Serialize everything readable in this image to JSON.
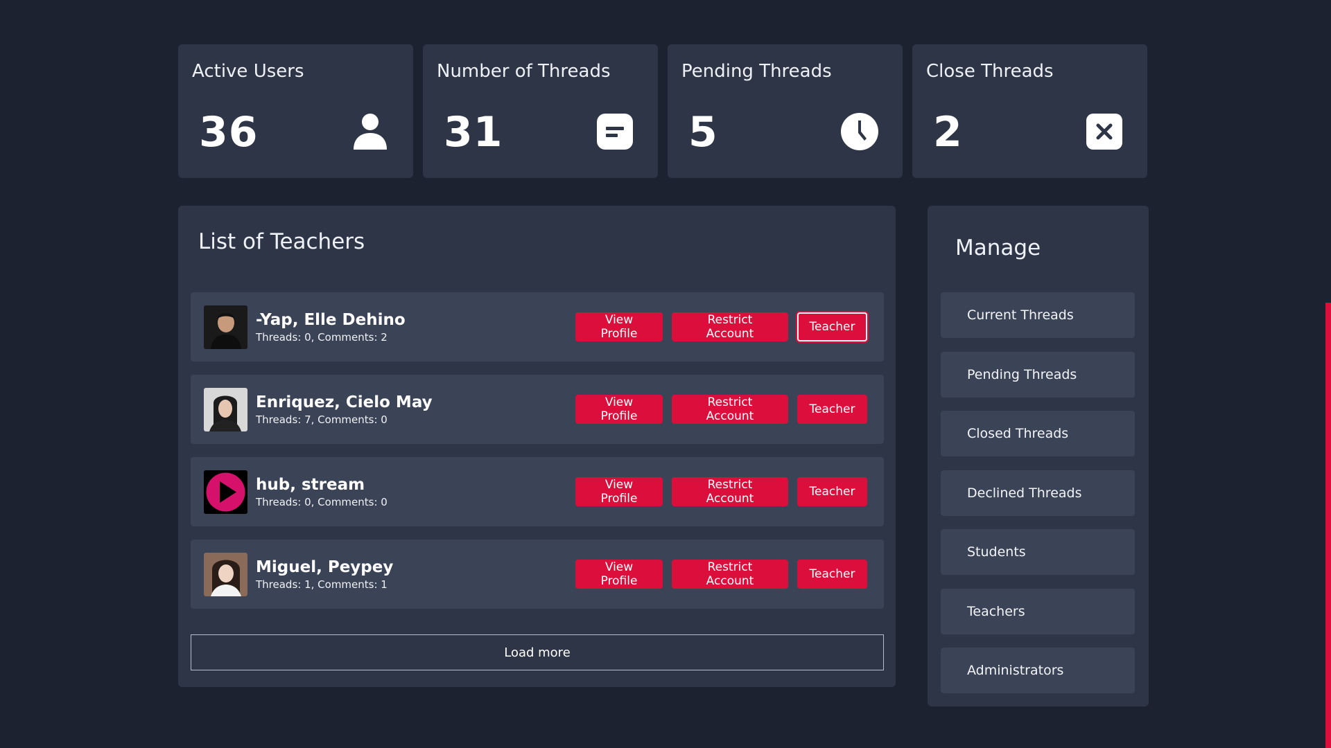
{
  "colors": {
    "background": "#1c2230",
    "card": "#2e3546",
    "row": "#3b4356",
    "accent": "#dc0f3c"
  },
  "stats": [
    {
      "title": "Active Users",
      "value": "36",
      "icon": "user-icon"
    },
    {
      "title": "Number of Threads",
      "value": "31",
      "icon": "message-icon"
    },
    {
      "title": "Pending Threads",
      "value": "5",
      "icon": "clock-icon"
    },
    {
      "title": "Close Threads",
      "value": "2",
      "icon": "close-box-icon"
    }
  ],
  "teachers_panel": {
    "title": "List of Teachers",
    "buttons": {
      "view": "View Profile",
      "restrict": "Restrict Account",
      "role": "Teacher"
    },
    "teachers": [
      {
        "name": "-Yap, Elle Dehino",
        "stats": "Threads: 0, Comments: 2",
        "avatar": "photo-avatar"
      },
      {
        "name": "Enriquez, Cielo May",
        "stats": "Threads: 7, Comments: 0",
        "avatar": "photo-avatar"
      },
      {
        "name": "hub, stream",
        "stats": "Threads: 0, Comments: 0",
        "avatar": "play-logo-avatar"
      },
      {
        "name": "Miguel, Peypey",
        "stats": "Threads: 1, Comments: 1",
        "avatar": "photo-avatar"
      }
    ],
    "load_more": "Load more"
  },
  "manage": {
    "title": "Manage",
    "items": [
      "Current Threads",
      "Pending Threads",
      "Closed Threads",
      "Declined Threads",
      "Students",
      "Teachers",
      "Administrators"
    ]
  }
}
